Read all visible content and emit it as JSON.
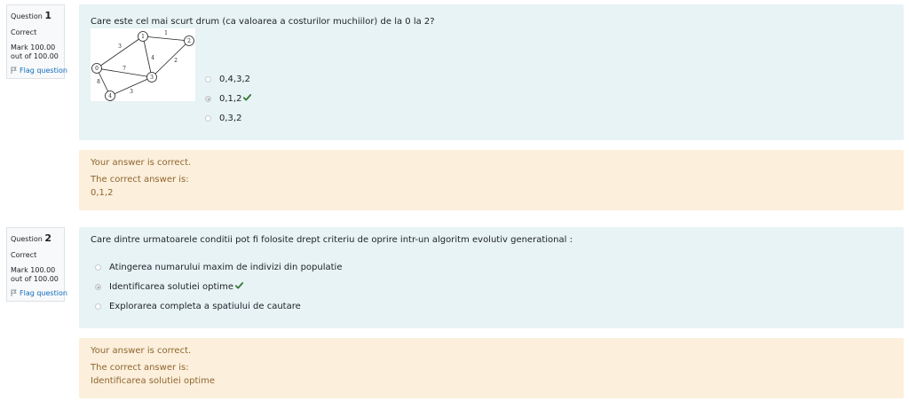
{
  "questions": [
    {
      "number_prefix": "Question",
      "number": "1",
      "state": "Correct",
      "grade": "Mark 100.00 out of 100.00",
      "flag_label": "Flag question",
      "text": "Care este cel mai scurt drum (ca valoarea a costurilor muchiilor) de la 0 la 2?",
      "answers": [
        {
          "label": "0,4,3,2",
          "checked": false,
          "correct_mark": false
        },
        {
          "label": "0,1,2",
          "checked": true,
          "correct_mark": true
        },
        {
          "label": "0,3,2",
          "checked": false,
          "correct_mark": false
        }
      ],
      "feedback": {
        "result": "Your answer is correct.",
        "right_answer_label": "The correct answer is:",
        "right_answer": "0,1,2"
      },
      "graph": {
        "nodes": [
          "0",
          "1",
          "2",
          "3",
          "4"
        ],
        "edge_labels": [
          "1",
          "3",
          "7",
          "4",
          "2",
          "8",
          "3"
        ]
      }
    },
    {
      "number_prefix": "Question",
      "number": "2",
      "state": "Correct",
      "grade": "Mark 100.00 out of 100.00",
      "flag_label": "Flag question",
      "text": "Care dintre urmatoarele conditii pot fi folosite drept criteriu de oprire intr-un algoritm evolutiv generational :",
      "answers": [
        {
          "label": "Atingerea numarului maxim de indivizi din populatie",
          "checked": false,
          "correct_mark": false
        },
        {
          "label": "Identificarea solutiei optime",
          "checked": true,
          "correct_mark": true
        },
        {
          "label": "Explorarea completa a spatiului de cautare",
          "checked": false,
          "correct_mark": false
        }
      ],
      "feedback": {
        "result": "Your answer is correct.",
        "right_answer_label": "The correct answer is:",
        "right_answer": "Identificarea solutiei optime"
      }
    }
  ],
  "colors": {
    "formulation_bg": "#e7f3f5",
    "feedback_bg": "#fcefdc",
    "feedback_text": "#8e662e",
    "link": "#0f6cbf",
    "check": "#357a32"
  },
  "icons": {
    "flag": "flag-icon",
    "correct": "check-icon"
  }
}
